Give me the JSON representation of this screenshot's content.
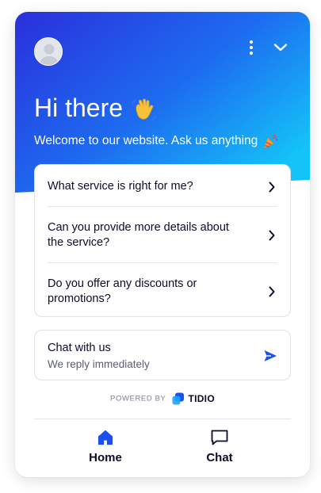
{
  "header": {
    "title": "Hi there",
    "title_emoji": "waving-hand-icon",
    "subtitle": "Welcome to our website. Ask us anything",
    "subtitle_emoji": "party-popper-icon",
    "gradient_start": "#2b3ce0",
    "gradient_end": "#12c2f7"
  },
  "faq": [
    {
      "label": "What service is right for me?"
    },
    {
      "label": "Can you provide more details about the service?"
    },
    {
      "label": "Do you offer any discounts or promotions?"
    }
  ],
  "chat_card": {
    "title": "Chat with us",
    "subtitle": "We reply immediately",
    "icon": "send-icon"
  },
  "powered_by": {
    "prefix": "POWERED BY",
    "brand": "TIDIO"
  },
  "nav": {
    "home_label": "Home",
    "chat_label": "Chat"
  },
  "colors": {
    "accent": "#1a4ff0",
    "text": "#0b0b2c"
  }
}
